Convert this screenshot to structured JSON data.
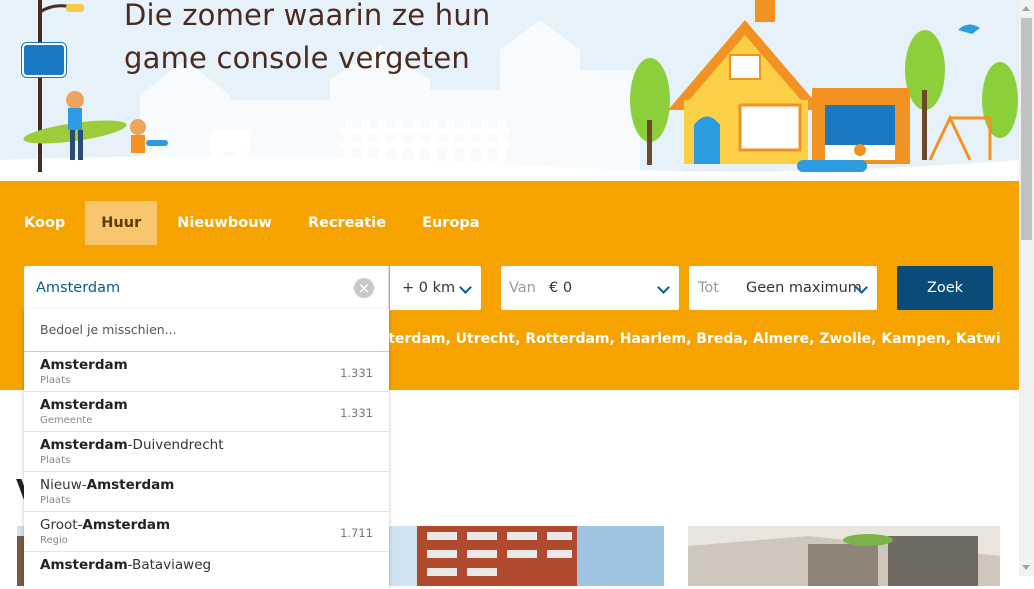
{
  "hero": {
    "title_line1": "Die zomer waarin ze hun",
    "title_line2": "game console vergeten"
  },
  "tabs": [
    {
      "label": "Koop",
      "active": false
    },
    {
      "label": "Huur",
      "active": true
    },
    {
      "label": "Nieuwbouw",
      "active": false
    },
    {
      "label": "Recreatie",
      "active": false
    },
    {
      "label": "Europa",
      "active": false
    }
  ],
  "search": {
    "location_value": "Amsterdam",
    "radius_value": "+ 0 km",
    "van_prefix": "Van",
    "van_value": "€ 0",
    "tot_prefix": "Tot",
    "tot_value": "Geen maximum",
    "submit_label": "Zoek",
    "suggest_text": "sterdam, Utrecht, Rotterdam, Haarlem, Breda, Almere, Zwolle, Kampen, Katwijk of"
  },
  "dropdown": {
    "heading": "Bedoel je misschien...",
    "items": [
      {
        "pre": "",
        "bold": "Amsterdam",
        "post": "",
        "type": "Plaats",
        "count": "1.331"
      },
      {
        "pre": "",
        "bold": "Amsterdam",
        "post": "",
        "type": "Gemeente",
        "count": "1.331"
      },
      {
        "pre": "",
        "bold": "Amsterdam",
        "post": "-Duivendrecht",
        "type": "Plaats",
        "count": ""
      },
      {
        "pre": "Nieuw-",
        "bold": "Amsterdam",
        "post": "",
        "type": "Plaats",
        "count": ""
      },
      {
        "pre": "Groot-",
        "bold": "Amsterdam",
        "post": "",
        "type": "Regio",
        "count": "1.711"
      },
      {
        "pre": "",
        "bold": "Amsterdam",
        "post": "-Bataviaweg",
        "type": "",
        "count": ""
      }
    ]
  },
  "content": {
    "partial_heading": "V"
  },
  "colors": {
    "band": "#f6a300",
    "active_tab": "#f9c56e",
    "button": "#0a4b78",
    "hero_sky": "#e6f1f9"
  }
}
